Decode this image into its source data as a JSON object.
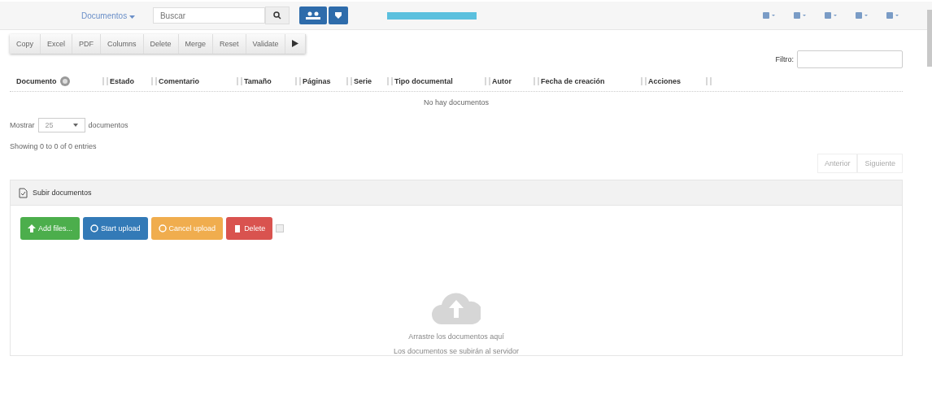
{
  "navbar": {
    "menu": "Documentos",
    "search": {
      "placeholder": "Buscar"
    }
  },
  "toolbar": {
    "buttons": [
      "Copy",
      "Excel",
      "PDF",
      "Columns",
      "Delete",
      "Merge",
      "Reset",
      "Validate"
    ]
  },
  "filter": {
    "label": "Filtro:"
  },
  "table": {
    "columns": [
      {
        "label": "Documento",
        "info": true
      },
      {
        "label": "Estado",
        "info": false
      },
      {
        "label": "Comentario",
        "info": false
      },
      {
        "label": "Tamaño",
        "info": false
      },
      {
        "label": "Páginas",
        "info": false
      },
      {
        "label": "Serie",
        "info": false
      },
      {
        "label": "Tipo documental",
        "info": false
      },
      {
        "label": "Autor",
        "info": false
      },
      {
        "label": "Fecha de creación",
        "info": false
      },
      {
        "label": "Acciones",
        "info": false
      }
    ],
    "empty": "No hay documentos"
  },
  "length": {
    "before": "Mostrar",
    "value": "25",
    "after": "documentos"
  },
  "info": "Showing 0 to 0 of 0 entries",
  "pagination": [
    "Anterior",
    "Siguiente"
  ],
  "upload": {
    "title": "Subir documentos",
    "buttons": [
      {
        "kind": "add",
        "label": "Add files..."
      },
      {
        "kind": "start",
        "label": "Start upload"
      },
      {
        "kind": "cancel",
        "label": "Cancel upload"
      },
      {
        "kind": "delete",
        "label": "Delete"
      }
    ],
    "drop_text": "Arrastre los documentos aquí",
    "drop_hint": "Los documentos se subirán al servidor",
    "select_all": {
      "checked": false
    }
  }
}
